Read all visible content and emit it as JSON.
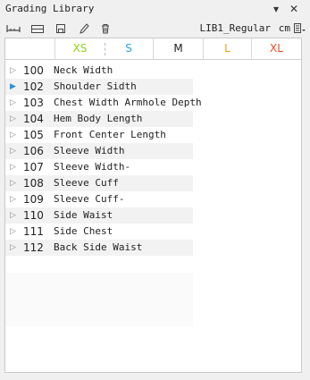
{
  "window": {
    "title": "Grading Library",
    "minimize_glyph": "▾",
    "close_glyph": "✕"
  },
  "toolbar": {
    "library_name": "LIB1_Regular",
    "unit": "cm",
    "icons": [
      "ruler-icon",
      "rectangle-icon",
      "save-icon",
      "pencil-icon",
      "trash-icon",
      "menu-list-icon"
    ]
  },
  "sizes": [
    {
      "label": "XS",
      "color": "#8fd21e"
    },
    {
      "label": "S",
      "color": "#2aa3e6"
    },
    {
      "label": "M",
      "color": "#222222"
    },
    {
      "label": "L",
      "color": "#f0a01e"
    },
    {
      "label": "XL",
      "color": "#e8501e"
    }
  ],
  "rows": [
    {
      "num": "100",
      "name": "Neck Width",
      "active": false
    },
    {
      "num": "102",
      "name": "Shoulder Sidth",
      "active": true
    },
    {
      "num": "103",
      "name": "Chest Width Armhole Depth",
      "active": false
    },
    {
      "num": "104",
      "name": "Hem Body Length",
      "active": false
    },
    {
      "num": "105",
      "name": "Front Center Length",
      "active": false
    },
    {
      "num": "106",
      "name": "Sleeve Width",
      "active": false
    },
    {
      "num": "107",
      "name": "Sleeve Width-",
      "active": false
    },
    {
      "num": "108",
      "name": "Sleeve Cuff",
      "active": false
    },
    {
      "num": "109",
      "name": "Sleeve Cuff-",
      "active": false
    },
    {
      "num": "110",
      "name": "Side Waist",
      "active": false
    },
    {
      "num": "111",
      "name": "Side Chest",
      "active": false
    },
    {
      "num": "112",
      "name": "Back Side Waist",
      "active": false
    }
  ]
}
